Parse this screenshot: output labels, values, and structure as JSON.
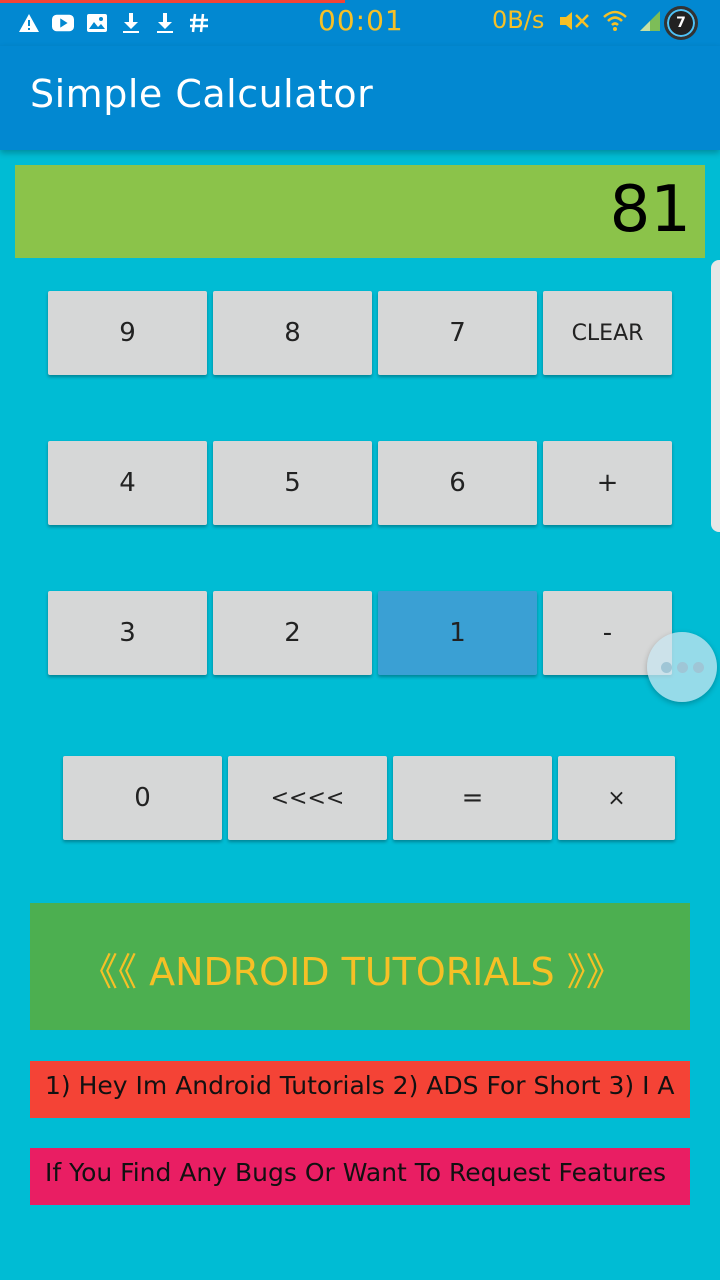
{
  "status_bar": {
    "time": "00:01",
    "speed": "0B/s",
    "battery_level": "7",
    "left_icons": [
      "warning-icon",
      "youtube-icon",
      "image-icon",
      "download-icon",
      "download-icon",
      "hash-icon"
    ],
    "right_icons": [
      "mute-icon",
      "wifi-icon",
      "signal-icon"
    ],
    "time_color": "#f6c026"
  },
  "app": {
    "title": "Simple Calculator",
    "bar_color": "#0288d1",
    "background_color": "#00bcd4"
  },
  "display": {
    "value": "81",
    "color": "#8bc34a"
  },
  "keypad": {
    "row1": [
      "9",
      "8",
      "7",
      "CLEAR"
    ],
    "row2": [
      "4",
      "5",
      "6",
      "+"
    ],
    "row3": [
      "3",
      "2",
      "1",
      "-"
    ],
    "row4": [
      "0",
      "<<<<",
      "=",
      "×"
    ],
    "pressed_key": "1",
    "key_color": "#d6d7d7",
    "pressed_color": "#3aa0d4"
  },
  "banners": {
    "title": "《《  ANDROID  TUTORIALS  》》",
    "ticker": "1)  Hey  Im  Android  Tutorials    2)  ADS  For  Short    3)  I  A",
    "notice": "If  You  Find  Any  Bugs  Or  Want  To  Request  Features",
    "green": "#4caf50",
    "red": "#f44336",
    "pink": "#e91e63",
    "title_color": "#f6c026"
  }
}
